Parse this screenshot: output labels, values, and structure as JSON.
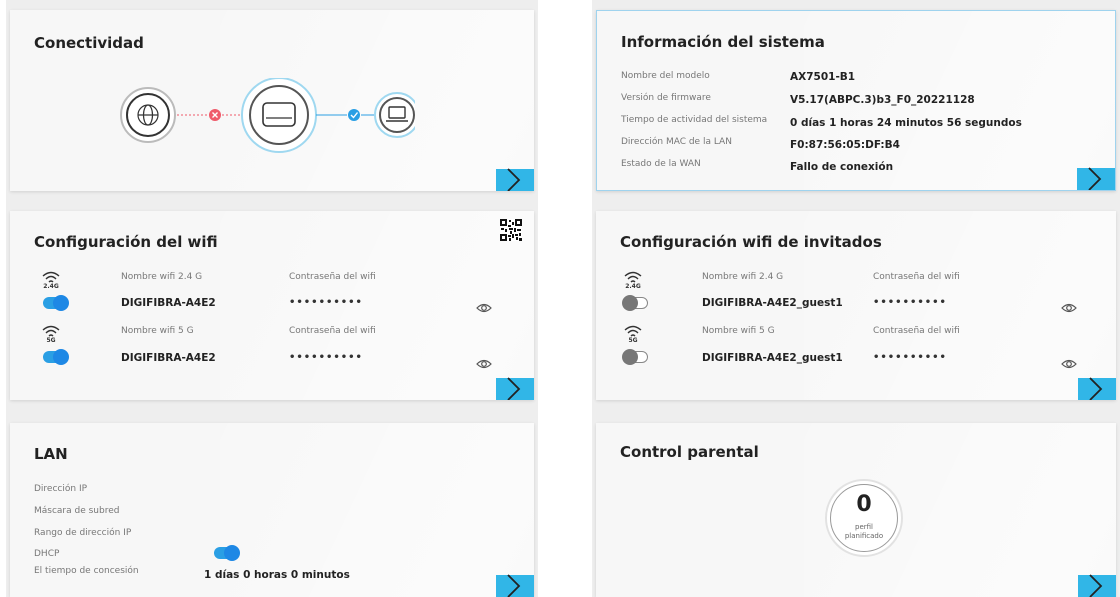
{
  "connectivity": {
    "title": "Conectividad",
    "internet_status": "error",
    "device_status": "ok"
  },
  "system_info": {
    "title": "Información del sistema",
    "rows": [
      {
        "label": "Nombre del modelo",
        "value": "AX7501-B1"
      },
      {
        "label": "Versión de firmware",
        "value": "V5.17(ABPC.3)b3_F0_20221128"
      },
      {
        "label": "Tiempo de actividad del sistema",
        "value": "0 días 1 horas 24 minutos 56 segundos"
      },
      {
        "label": "Dirección MAC de la LAN",
        "value": "F0:87:56:05:DF:B4"
      },
      {
        "label": "Estado de la WAN",
        "value": "Fallo de conexión"
      }
    ]
  },
  "wifi": {
    "title": "Configuración del wifi",
    "networks": [
      {
        "band": "2.4G",
        "name_label": "Nombre wifi 2.4 G",
        "name": "DIGIFIBRA-A4E2",
        "pw_label": "Contraseña del wifi",
        "password": "••••••••••",
        "enabled": true
      },
      {
        "band": "5G",
        "name_label": "Nombre wifi 5 G",
        "name": "DIGIFIBRA-A4E2",
        "pw_label": "Contraseña del wifi",
        "password": "••••••••••",
        "enabled": true
      }
    ]
  },
  "guest_wifi": {
    "title": "Configuración wifi de invitados",
    "networks": [
      {
        "band": "2.4G",
        "name_label": "Nombre wifi 2.4 G",
        "name": "DIGIFIBRA-A4E2_guest1",
        "pw_label": "Contraseña del wifi",
        "password": "••••••••••",
        "enabled": false
      },
      {
        "band": "5G",
        "name_label": "Nombre wifi 5 G",
        "name": "DIGIFIBRA-A4E2_guest1",
        "pw_label": "Contraseña del wifi",
        "password": "••••••••••",
        "enabled": false
      }
    ]
  },
  "lan": {
    "title": "LAN",
    "ip_label": "Dirección IP",
    "mask_label": "Máscara de subred",
    "range_label": "Rango de dirección IP",
    "dhcp_label": "DHCP",
    "dhcp_enabled": true,
    "lease_label": "El tiempo de concesión",
    "lease_value": "1 días 0 horas 0 minutos"
  },
  "parental": {
    "title": "Control parental",
    "count": "0",
    "caption_line1": "perfil",
    "caption_line2": "planificado"
  },
  "colors": {
    "accent": "#31b6e7",
    "toggle_on": "#1e88e5",
    "error": "#ef5a6a",
    "ok": "#2a9fe4"
  }
}
